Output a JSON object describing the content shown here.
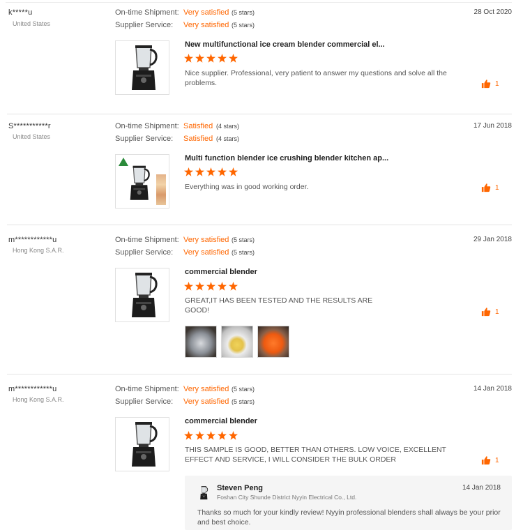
{
  "labels": {
    "ontime": "On-time Shipment:",
    "supplier": "Supplier Service:"
  },
  "reviews": [
    {
      "user": "k*****u",
      "country": "United States",
      "date": "28 Oct 2020",
      "ontime_value": "Very satisfied",
      "ontime_stars": "(5 stars)",
      "supplier_value": "Very satisfied",
      "supplier_stars": "(5 stars)",
      "product_title": "New multifunctional ice cream blender commercial el...",
      "rating": 5,
      "text": "Nice supplier. Professional, very patient to answer my questions and solve all the problems.",
      "helpful_count": "1"
    },
    {
      "user": "S***********r",
      "country": "United States",
      "date": "17 Jun 2018",
      "ontime_value": "Satisfied",
      "ontime_stars": "(4 stars)",
      "supplier_value": "Satisfied",
      "supplier_stars": "(4 stars)",
      "product_title": "Multi function blender ice crushing blender kitchen ap...",
      "rating": 5,
      "text": "Everything was in good working order.",
      "helpful_count": "1"
    },
    {
      "user": "m************u",
      "country": "Hong Kong S.A.R.",
      "date": "29 Jan 2018",
      "ontime_value": "Very satisfied",
      "ontime_stars": "(5 stars)",
      "supplier_value": "Very satisfied",
      "supplier_stars": "(5 stars)",
      "product_title": "commercial blender",
      "rating": 5,
      "text": "GREAT,IT HAS BEEN TESTED AND THE RESULTS ARE GOOD!",
      "helpful_count": "1",
      "photos": 3
    },
    {
      "user": "m************u",
      "country": "Hong Kong S.A.R.",
      "date": "14 Jan 2018",
      "ontime_value": "Very satisfied",
      "ontime_stars": "(5 stars)",
      "supplier_value": "Very satisfied",
      "supplier_stars": "(5 stars)",
      "product_title": "commercial blender",
      "rating": 5,
      "text": "THIS SAMPLE IS GOOD, BETTER THAN OTHERS. LOW VOICE, EXCELLENT EFFECT AND SERVICE, I WILL CONSIDER THE BULK ORDER",
      "helpful_count": "1",
      "reply": {
        "name": "Steven Peng",
        "company": "Foshan City Shunde District Nyyin Electrical Co., Ltd.",
        "date": "14 Jan 2018",
        "text": "Thanks so much for your kindly review! Nyyin professional blenders shall always be your prior and best choice."
      }
    }
  ],
  "colors": {
    "accent": "#ff6600",
    "divider": "#e3e3e3",
    "reply_bg": "#f5f5f5"
  },
  "icons": {
    "helpful": "thumbs-up-icon",
    "rating": "star-icon"
  }
}
